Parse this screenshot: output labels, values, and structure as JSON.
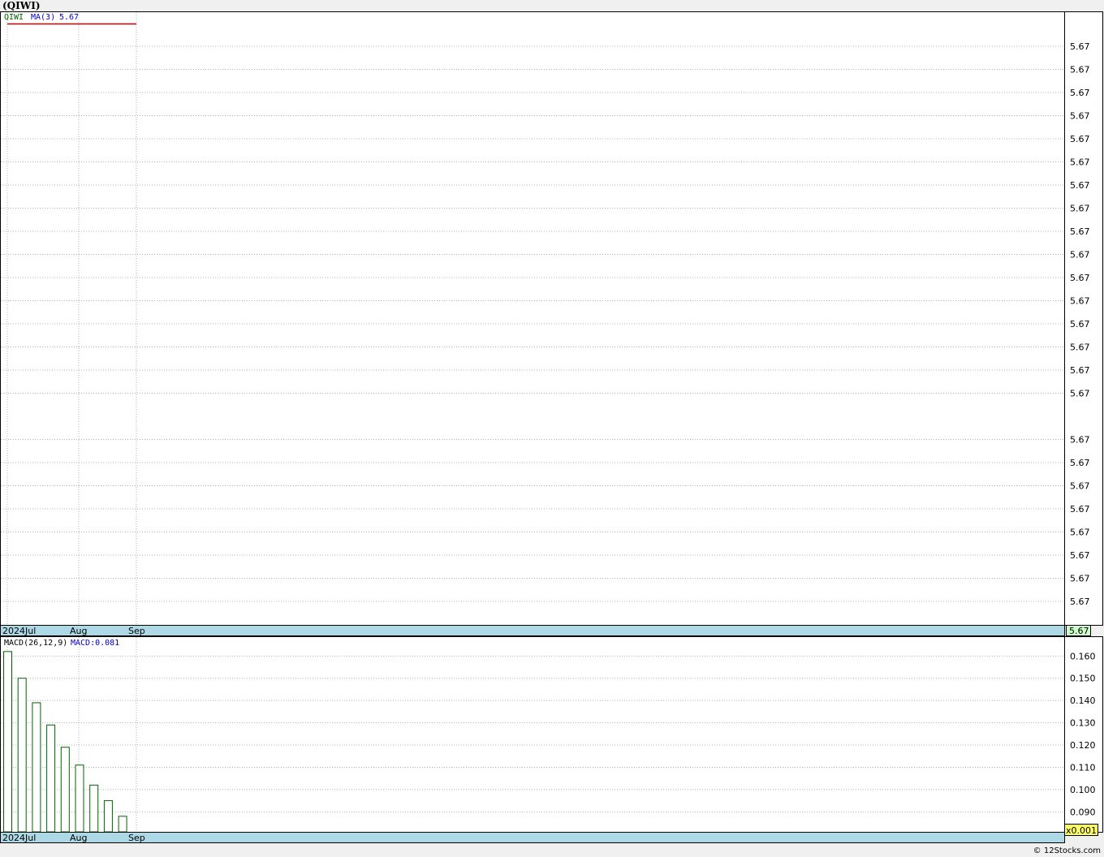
{
  "title": "(QIWI)",
  "copyright": "© 12Stocks.com",
  "colors": {
    "background": "#f0f0f0",
    "panel": "#ffffff",
    "axis_band": "#add8e6",
    "grid": "#b0b0b0",
    "ma_line": "#cc0000",
    "macd_bar": "#006400",
    "legend_ticker": "#006400",
    "legend_ma": "#0000cc",
    "current_value_box": "#ccffcc",
    "multiplier_box": "#ffff66"
  },
  "chart_data": [
    {
      "type": "line",
      "name": "price-panel",
      "legend": {
        "ticker": "QIWI",
        "ma_label": "MA(3)",
        "ma_value": "5.67"
      },
      "x_ticks": [
        "2024Jul",
        "Aug",
        "Sep"
      ],
      "y_tick_labels": [
        "5.67",
        "5.67",
        "5.67",
        "5.67",
        "5.67",
        "5.67",
        "5.67",
        "5.67",
        "5.67",
        "5.67",
        "5.67",
        "5.67",
        "5.67",
        "5.67",
        "5.67",
        "5.67",
        "5.67",
        "5.67",
        "5.67",
        "5.67",
        "5.67",
        "5.67",
        "5.67",
        "5.67"
      ],
      "current_value": "5.67",
      "series": [
        {
          "name": "MA(3)",
          "values": [
            5.67,
            5.67,
            5.67,
            5.67,
            5.67,
            5.67,
            5.67,
            5.67,
            5.67
          ]
        }
      ],
      "grid": true
    },
    {
      "type": "bar",
      "name": "macd-panel",
      "legend": {
        "label": "MACD(26,12,9)",
        "value_label": "MACD:0.081"
      },
      "x_ticks": [
        "2024Jul",
        "Aug",
        "Sep"
      ],
      "y_ticks": [
        0.16,
        0.15,
        0.14,
        0.13,
        0.12,
        0.11,
        0.1,
        0.09
      ],
      "y_tick_labels": [
        "0.160",
        "0.150",
        "0.140",
        "0.130",
        "0.120",
        "0.110",
        "0.100",
        "0.090"
      ],
      "ylim": [
        0.081,
        0.1685
      ],
      "multiplier": "x0.001",
      "values": [
        0.162,
        0.15,
        0.139,
        0.129,
        0.119,
        0.111,
        0.102,
        0.095,
        0.088
      ],
      "grid": true
    }
  ]
}
